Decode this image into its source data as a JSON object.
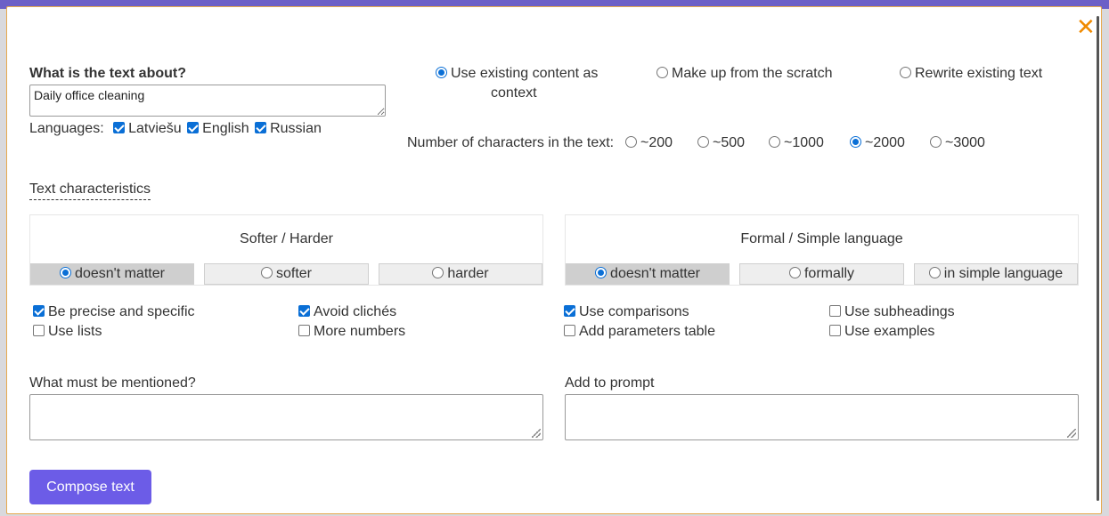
{
  "dialog": {
    "close_label": "✕"
  },
  "topic": {
    "label": "What is the text about?",
    "value": "Daily office cleaning"
  },
  "languages": {
    "label": "Languages:",
    "items": [
      {
        "label": "Latviešu",
        "checked": true
      },
      {
        "label": "English",
        "checked": true
      },
      {
        "label": "Russian",
        "checked": true
      }
    ]
  },
  "mode": {
    "options": [
      {
        "label_line1": "Use existing content as",
        "label_line2": "context",
        "selected": true
      },
      {
        "label_line1": "Make up from the scratch",
        "selected": false
      },
      {
        "label_line1": "Rewrite existing text",
        "selected": false
      }
    ]
  },
  "length": {
    "label": "Number of characters in the text:",
    "options": [
      {
        "label": "~200",
        "selected": false
      },
      {
        "label": "~500",
        "selected": false
      },
      {
        "label": "~1000",
        "selected": false
      },
      {
        "label": "~2000",
        "selected": true
      },
      {
        "label": "~3000",
        "selected": false
      }
    ]
  },
  "characteristics": {
    "link_label": "Text characteristics",
    "softer_harder": {
      "title": "Softer / Harder",
      "options": [
        {
          "label": "doesn't matter",
          "selected": true
        },
        {
          "label": "softer",
          "selected": false
        },
        {
          "label": "harder",
          "selected": false
        }
      ]
    },
    "formal_simple": {
      "title": "Formal / Simple language",
      "options": [
        {
          "label": "doesn't matter",
          "selected": true
        },
        {
          "label": "formally",
          "selected": false
        },
        {
          "label": "in simple language",
          "selected": false
        }
      ]
    },
    "checkboxes": [
      {
        "label": "Be precise and specific",
        "checked": true
      },
      {
        "label": "Use lists",
        "checked": false
      },
      {
        "label": "Avoid clichés",
        "checked": true
      },
      {
        "label": "More numbers",
        "checked": false
      },
      {
        "label": "Use comparisons",
        "checked": true
      },
      {
        "label": "Add parameters table",
        "checked": false
      },
      {
        "label": "Use subheadings",
        "checked": false
      },
      {
        "label": "Use examples",
        "checked": false
      }
    ]
  },
  "mentions": {
    "label": "What must be mentioned?",
    "value": ""
  },
  "prompt": {
    "label": "Add to prompt",
    "value": ""
  },
  "compose_button": "Compose text"
}
